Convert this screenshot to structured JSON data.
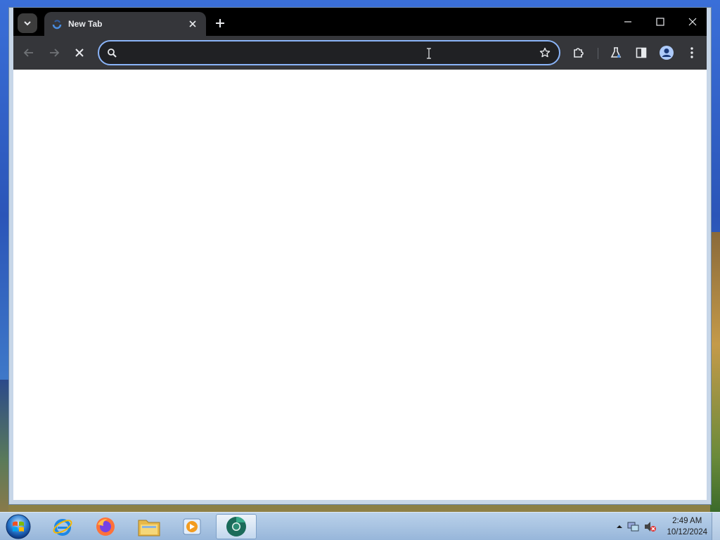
{
  "browser": {
    "tab": {
      "title": "New Tab"
    },
    "omnibox": {
      "value": "",
      "placeholder": ""
    },
    "colors": {
      "frame": "#000000",
      "toolbar": "#35363a",
      "omnibox_border": "#8ab4f8",
      "content": "#ffffff"
    }
  },
  "taskbar": {
    "apps": [
      {
        "name": "Internet Explorer",
        "icon": "internet-explorer-icon"
      },
      {
        "name": "Firefox",
        "icon": "firefox-icon"
      },
      {
        "name": "File Explorer",
        "icon": "folder-icon"
      },
      {
        "name": "Media Player",
        "icon": "media-player-icon"
      },
      {
        "name": "Chrome Dev",
        "icon": "chrome-dev-icon",
        "active": true
      }
    ],
    "clock": {
      "time": "2:49 AM",
      "date": "10/12/2024"
    }
  }
}
